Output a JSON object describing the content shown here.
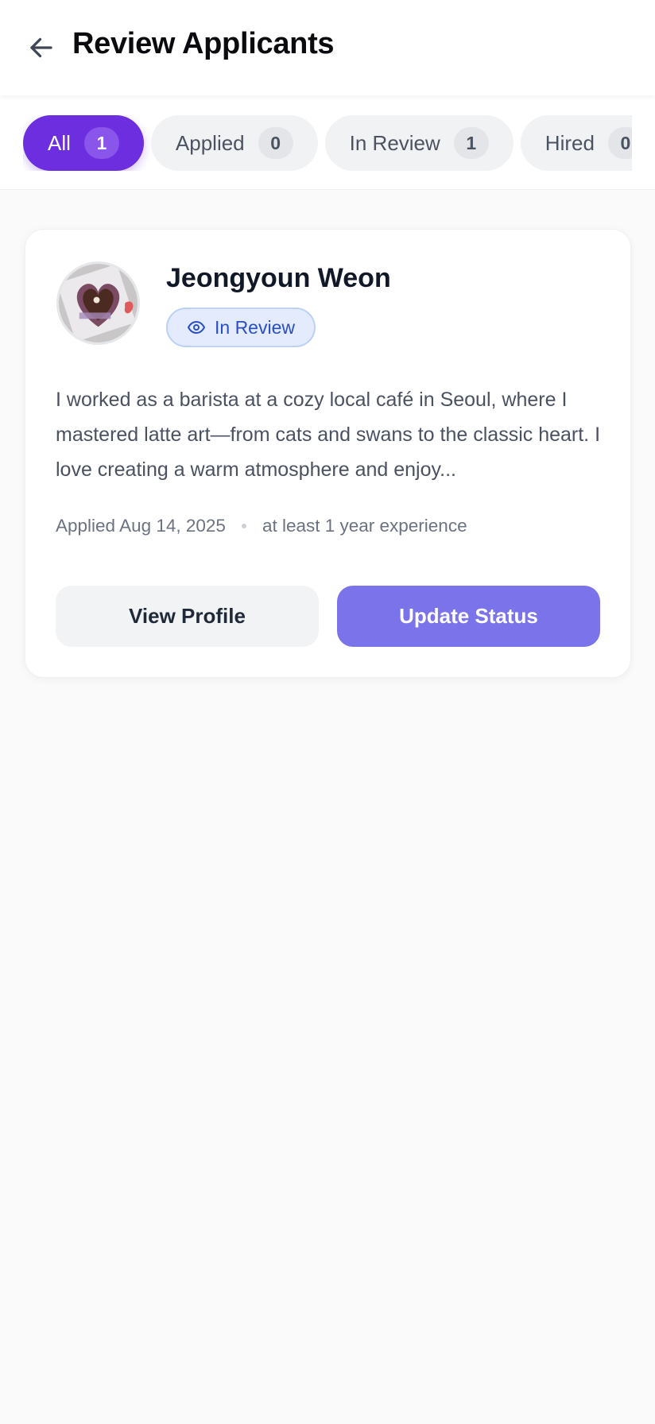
{
  "header": {
    "title": "Review Applicants"
  },
  "filters": [
    {
      "label": "All",
      "count": "1",
      "active": true
    },
    {
      "label": "Applied",
      "count": "0",
      "active": false
    },
    {
      "label": "In Review",
      "count": "1",
      "active": false
    },
    {
      "label": "Hired",
      "count": "0",
      "active": false
    }
  ],
  "applicant": {
    "name": "Jeongyoun Weon",
    "status": "In Review",
    "cover_letter": "I worked as a barista at a cozy local café in Seoul, where I mastered latte art—from cats and swans to the classic heart. I love creating a warm atmosphere and enjoy...",
    "applied": "Applied Aug 14, 2025",
    "experience": "at least 1 year experience",
    "view_profile_label": "View Profile",
    "update_status_label": "Update Status"
  },
  "colors": {
    "accent": "#6d2ee0",
    "primary_button": "#7b73ea",
    "status_badge_bg": "#e3ebfd",
    "status_badge_text": "#2a4ec4"
  },
  "icons": {
    "back": "arrow-left-icon",
    "status": "eye-icon"
  }
}
